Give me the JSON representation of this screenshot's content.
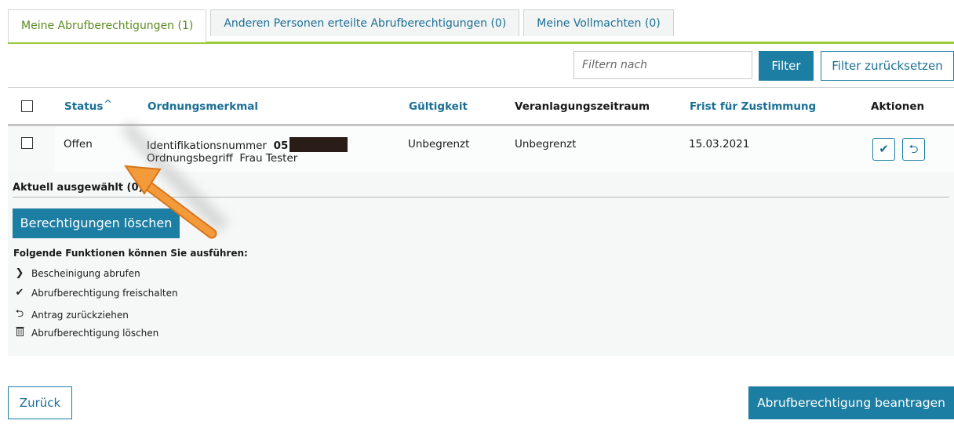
{
  "tabs": [
    {
      "label": "Meine Abrufberechtigungen (1)",
      "active": true
    },
    {
      "label": "Anderen Personen erteilte Abrufberechtigungen (0)",
      "active": false
    },
    {
      "label": "Meine Vollmachten (0)",
      "active": false
    }
  ],
  "filter": {
    "placeholder": "Filtern nach",
    "filter_label": "Filter",
    "reset_label": "Filter zurücksetzen"
  },
  "table": {
    "columns": {
      "status": "Status",
      "ordnungsmerkmal": "Ordnungsmerkmal",
      "gueltigkeit": "Gültigkeit",
      "veranlagungszeitraum": "Veranlagungszeitraum",
      "frist": "Frist für Zustimmung",
      "aktionen": "Aktionen"
    },
    "sort_indicator": "^",
    "rows": [
      {
        "status": "Offen",
        "id_label": "Identifikationsnummer",
        "id_value_visible": "05",
        "ordnungsbegriff_label": "Ordnungsbegriff",
        "ordnungsbegriff_value": "Frau Tester",
        "gueltigkeit": "Unbegrenzt",
        "veranlagungszeitraum": "Unbegrenzt",
        "frist": "15.03.2021"
      }
    ]
  },
  "selection": {
    "label": "Aktuell ausgewählt (0)",
    "delete_button": "Berechtigungen löschen"
  },
  "functions": {
    "title": "Folgende Funktionen können Sie ausführen:",
    "items": [
      {
        "icon": "chevron-right-icon",
        "label": "Bescheinigung abrufen"
      },
      {
        "icon": "checkmark-icon",
        "label": "Abrufberechtigung freischalten"
      },
      {
        "icon": "undo-icon",
        "label": "Antrag zurückziehen"
      },
      {
        "icon": "trash-icon",
        "label": "Abrufberechtigung löschen"
      }
    ]
  },
  "footer": {
    "back_label": "Zurück",
    "request_label": "Abrufberechtigung beantragen"
  },
  "colors": {
    "accent_blue": "#1d7ea3",
    "tab_rule_green": "#9ccb3b",
    "active_tab_text": "#5a8a1f",
    "annotation_arrow": "#f0922f"
  }
}
